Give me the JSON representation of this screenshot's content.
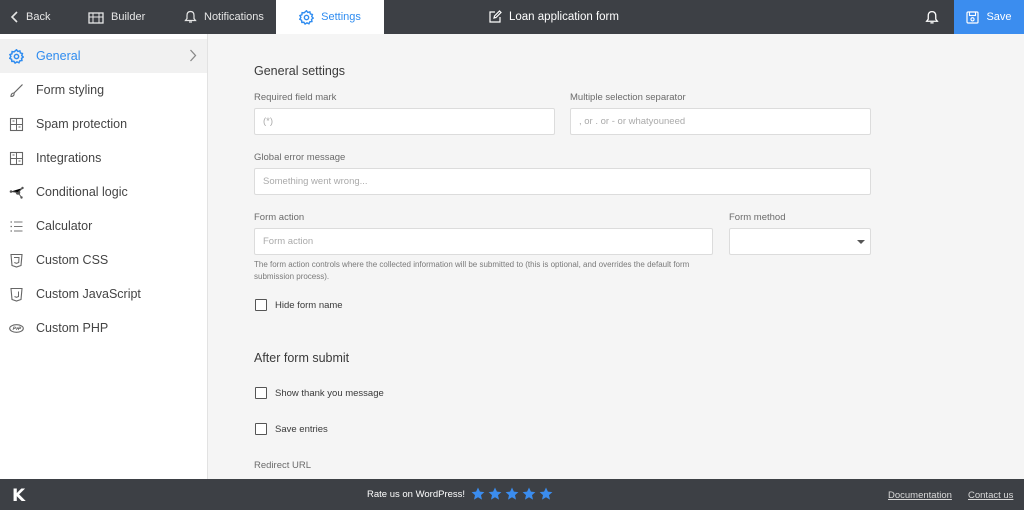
{
  "topbar": {
    "back": "Back",
    "builder": "Builder",
    "notifications": "Notifications",
    "settings": "Settings",
    "form_title": "Loan application form",
    "save": "Save"
  },
  "sidebar": {
    "items": [
      {
        "label": "General",
        "icon": "gear-icon"
      },
      {
        "label": "Form styling",
        "icon": "brush-icon"
      },
      {
        "label": "Spam protection",
        "icon": "grid-icon"
      },
      {
        "label": "Integrations",
        "icon": "grid-icon"
      },
      {
        "label": "Conditional logic",
        "icon": "nodes-icon"
      },
      {
        "label": "Calculator",
        "icon": "list-icon"
      },
      {
        "label": "Custom CSS",
        "icon": "css-icon"
      },
      {
        "label": "Custom JavaScript",
        "icon": "js-icon"
      },
      {
        "label": "Custom PHP",
        "icon": "php-icon"
      }
    ]
  },
  "general": {
    "heading": "General settings",
    "required_mark_label": "Required field mark",
    "required_mark_placeholder": "(*)",
    "separator_label": "Multiple selection separator",
    "separator_placeholder": ", or . or - or whatyouneed",
    "error_label": "Global error message",
    "error_placeholder": "Something went wrong...",
    "action_label": "Form action",
    "action_placeholder": "Form action",
    "method_label": "Form method",
    "action_help": "The form action controls where the collected information will be submitted to (this is optional, and overrides the default form submission process).",
    "hide_name_label": "Hide form name"
  },
  "after_submit": {
    "heading": "After form submit",
    "thank_you_label": "Show thank you message",
    "save_entries_label": "Save entries",
    "redirect_label": "Redirect URL"
  },
  "footer": {
    "logo": "K",
    "rate_text": "Rate us on WordPress!",
    "stars": 5,
    "documentation": "Documentation",
    "contact": "Contact us"
  },
  "colors": {
    "accent": "#2f8cf0",
    "dark_bar": "#3d4045",
    "save_button": "#3b8def"
  }
}
